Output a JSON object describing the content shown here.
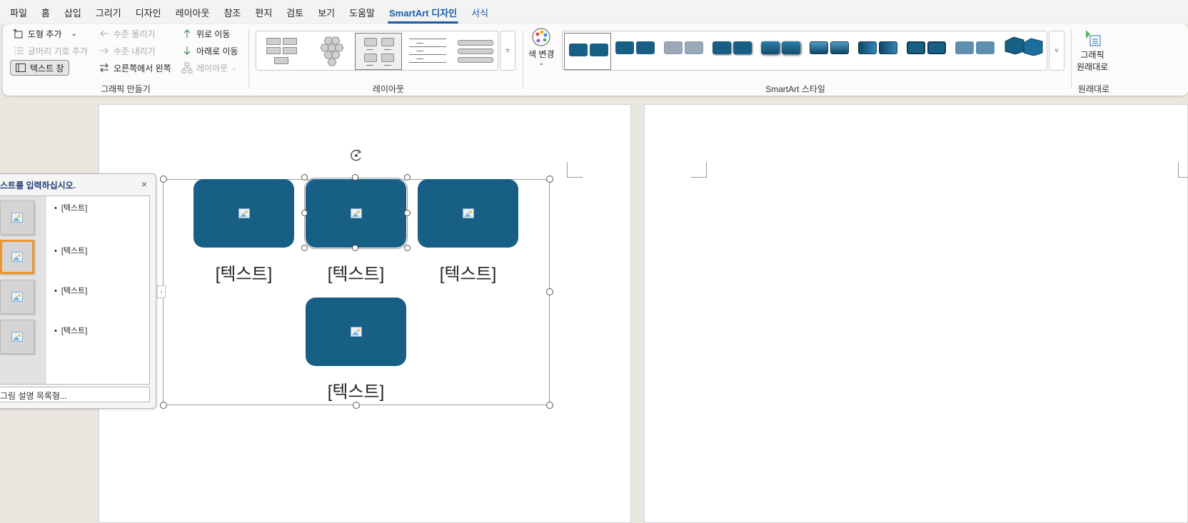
{
  "menu": {
    "tabs": [
      {
        "label": "파일"
      },
      {
        "label": "홈"
      },
      {
        "label": "삽입"
      },
      {
        "label": "그리기"
      },
      {
        "label": "디자인"
      },
      {
        "label": "레이아웃"
      },
      {
        "label": "참조"
      },
      {
        "label": "편지"
      },
      {
        "label": "검토"
      },
      {
        "label": "보기"
      },
      {
        "label": "도움말"
      },
      {
        "label": "SmartArt 디자인"
      },
      {
        "label": "서식"
      }
    ]
  },
  "ribbon": {
    "create_graphic": {
      "add_shape": "도형 추가",
      "add_bullet": "글머리 기호 추가",
      "text_pane": "텍스트 창",
      "promote": "수준 올리기",
      "demote": "수준 내리기",
      "right_to_left": "오른쪽에서 왼쪽",
      "move_up": "위로 이동",
      "move_down": "아래로 이동",
      "layout": "레이아웃",
      "group_label": "그래픽 만들기"
    },
    "layouts": {
      "group_label": "레이아웃"
    },
    "styles": {
      "change_colors": "색 변경",
      "group_label": "SmartArt 스타일"
    },
    "reset": {
      "reset_graphic_line1": "그래픽",
      "reset_graphic_line2": "원래대로",
      "group_label": "원래대로"
    },
    "colors": {
      "accent": "#185f86",
      "active_tab": "#1a5ea8"
    }
  },
  "smartart": {
    "shape_text": [
      "[텍스트]",
      "[텍스트]",
      "[텍스트]",
      "[텍스트]"
    ],
    "fill_color": "#185f86"
  },
  "text_pane": {
    "title": "스트를 입력하십시오.",
    "close_icon": "×",
    "bullets": [
      "[텍스트]",
      "[텍스트]",
      "[텍스트]",
      "[텍스트]"
    ],
    "footer": "그림 설명 목록형..."
  }
}
